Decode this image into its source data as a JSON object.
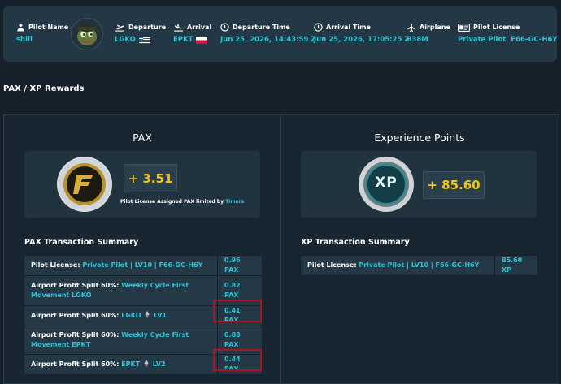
{
  "flight": {
    "pilot_name": {
      "label": "Pilot Name",
      "value": "shill"
    },
    "departure": {
      "label": "Departure",
      "value": "LGKO"
    },
    "arrival": {
      "label": "Arrival",
      "value": "EPKT"
    },
    "departure_time": {
      "label": "Departure Time",
      "value": "Jun 25, 2026, 14:43:59 Z"
    },
    "arrival_time": {
      "label": "Arrival Time",
      "value": "Jun 25, 2026, 17:05:25 Z"
    },
    "airplane": {
      "label": "Airplane",
      "value": "B38M"
    },
    "pilot_license": {
      "label": "Pilot License",
      "value": "Private Pilot  F66-GC-H6Y"
    }
  },
  "section_title": "PAX / XP Rewards",
  "pax": {
    "title": "PAX",
    "amount": "+ 3.51",
    "note_prefix": "Pilot License Assigned PAX limited by ",
    "note_link": "Timers",
    "summary_title": "PAX Transaction Summary",
    "rows": [
      {
        "label": "Pilot License: ",
        "link": "Private Pilot | LV10 | F66-GC-H6Y",
        "amount": "0.96 PAX"
      },
      {
        "label": "Airport Profit Split 60%: ",
        "link": "Weekly Cycle First Movement LGKO",
        "amount": "0.82 PAX"
      },
      {
        "label": "Airport Profit Split 60%: ",
        "link": "LGKO",
        "link2": "LV1",
        "amount": "0.41 PAX"
      },
      {
        "label": "Airport Profit Split 60%: ",
        "link": "Weekly Cycle First Movement EPKT",
        "amount": "0.88 PAX"
      },
      {
        "label": "Airport Profit Split 60%: ",
        "link": "EPKT",
        "link2": "LV2",
        "amount": "0.44 PAX"
      }
    ]
  },
  "xp": {
    "title": "Experience Points",
    "coin_text": "XP",
    "amount": "+ 85.60",
    "summary_title": "XP Transaction Summary",
    "rows": [
      {
        "label": "Pilot License: ",
        "link": "Private Pilot | LV10 | F66-GC-H6Y",
        "amount": "85.60 XP"
      }
    ]
  },
  "icons": [
    "pilot-icon",
    "takeoff-icon",
    "landing-icon",
    "clock-icon",
    "airplane-icon",
    "license-icon",
    "ethereum-icon"
  ],
  "colors": {
    "accent": "#2cc3d6",
    "amount": "#f2c21b",
    "highlight": "#a41724"
  }
}
